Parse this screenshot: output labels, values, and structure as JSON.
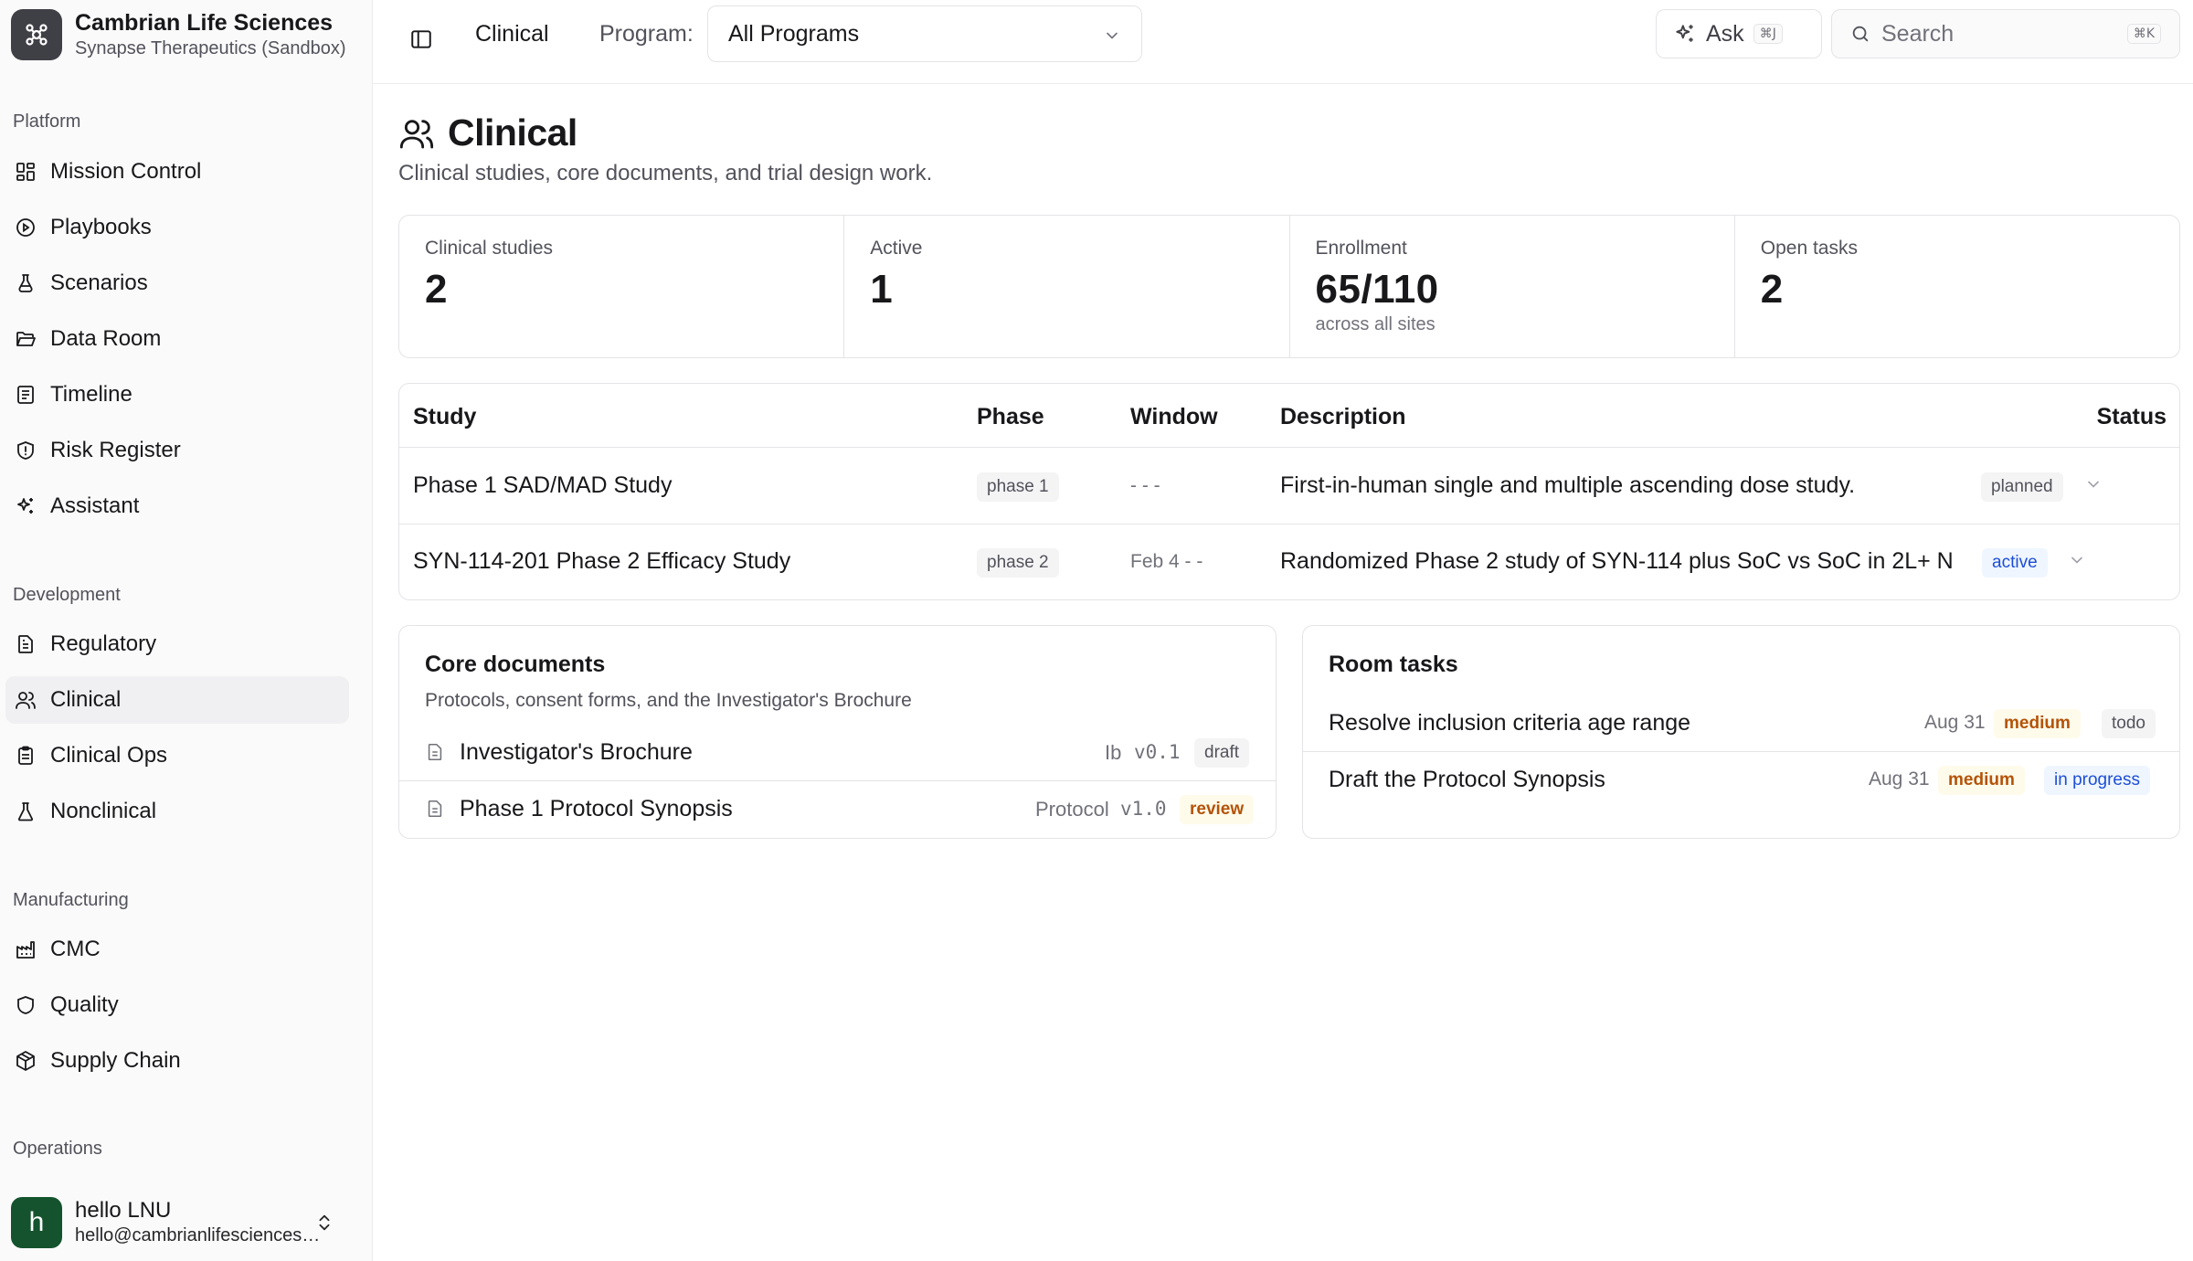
{
  "org": {
    "name": "Cambrian Life Sciences",
    "subtitle": "Synapse Therapeutics (Sandbox)"
  },
  "sidebar": {
    "sections": [
      {
        "label": "Platform",
        "items": [
          {
            "label": "Mission Control",
            "icon": "grid-icon"
          },
          {
            "label": "Playbooks",
            "icon": "play-circle-icon"
          },
          {
            "label": "Scenarios",
            "icon": "flask-icon"
          },
          {
            "label": "Data Room",
            "icon": "folder-open-icon"
          },
          {
            "label": "Timeline",
            "icon": "list-icon"
          },
          {
            "label": "Risk Register",
            "icon": "shield-alert-icon"
          },
          {
            "label": "Assistant",
            "icon": "sparkles-icon"
          }
        ]
      },
      {
        "label": "Development",
        "items": [
          {
            "label": "Regulatory",
            "icon": "file-text-icon"
          },
          {
            "label": "Clinical",
            "icon": "users-icon",
            "active": true
          },
          {
            "label": "Clinical Ops",
            "icon": "clipboard-icon"
          },
          {
            "label": "Nonclinical",
            "icon": "beaker-icon"
          }
        ]
      },
      {
        "label": "Manufacturing",
        "items": [
          {
            "label": "CMC",
            "icon": "factory-icon"
          },
          {
            "label": "Quality",
            "icon": "shield-icon"
          },
          {
            "label": "Supply Chain",
            "icon": "package-icon"
          }
        ]
      },
      {
        "label": "Operations",
        "items": []
      }
    ]
  },
  "user": {
    "initial": "h",
    "name": "hello LNU",
    "email": "hello@cambrianlifesciences.com"
  },
  "topbar": {
    "crumb": "Clinical",
    "program_label": "Program:",
    "program_value": "All Programs",
    "ask_label": "Ask",
    "ask_shortcut": "⌘J",
    "search_placeholder": "Search",
    "search_shortcut": "⌘K"
  },
  "page": {
    "title": "Clinical",
    "subtitle": "Clinical studies, core documents, and trial design work."
  },
  "stats": [
    {
      "label": "Clinical studies",
      "value": "2",
      "note": ""
    },
    {
      "label": "Active",
      "value": "1",
      "note": ""
    },
    {
      "label": "Enrollment",
      "value": "65/110",
      "note": "across all sites"
    },
    {
      "label": "Open tasks",
      "value": "2",
      "note": ""
    }
  ],
  "studies": {
    "headers": {
      "study": "Study",
      "phase": "Phase",
      "window": "Window",
      "description": "Description",
      "status": "Status"
    },
    "rows": [
      {
        "study": "Phase 1 SAD/MAD Study",
        "phase": "phase 1",
        "window": "- - -",
        "description": "First-in-human single and multiple ascending dose study.",
        "status": "planned"
      },
      {
        "study": "SYN-114-201 Phase 2 Efficacy Study",
        "phase": "phase 2",
        "window": "Feb 4 - -",
        "description": "Randomized Phase 2 study of SYN-114 plus SoC vs SoC in 2L+ N...",
        "status": "active"
      }
    ]
  },
  "core_documents": {
    "title": "Core documents",
    "subtitle": "Protocols, consent forms, and the Investigator's Brochure",
    "items": [
      {
        "name": "Investigator's Brochure",
        "type": "Ib",
        "version": "v0.1",
        "status": "draft"
      },
      {
        "name": "Phase 1 Protocol Synopsis",
        "type": "Protocol",
        "version": "v1.0",
        "status": "review"
      }
    ]
  },
  "room_tasks": {
    "title": "Room tasks",
    "items": [
      {
        "name": "Resolve inclusion criteria age range",
        "date": "Aug 31",
        "priority": "medium",
        "status": "todo"
      },
      {
        "name": "Draft the Protocol Synopsis",
        "date": "Aug 31",
        "priority": "medium",
        "status": "in progress"
      }
    ]
  },
  "colors": {
    "accent_blue": "#1d4ed8",
    "amber": "#b45309",
    "avatar_green": "#14532d",
    "logo_dark": "#3f3f46"
  }
}
